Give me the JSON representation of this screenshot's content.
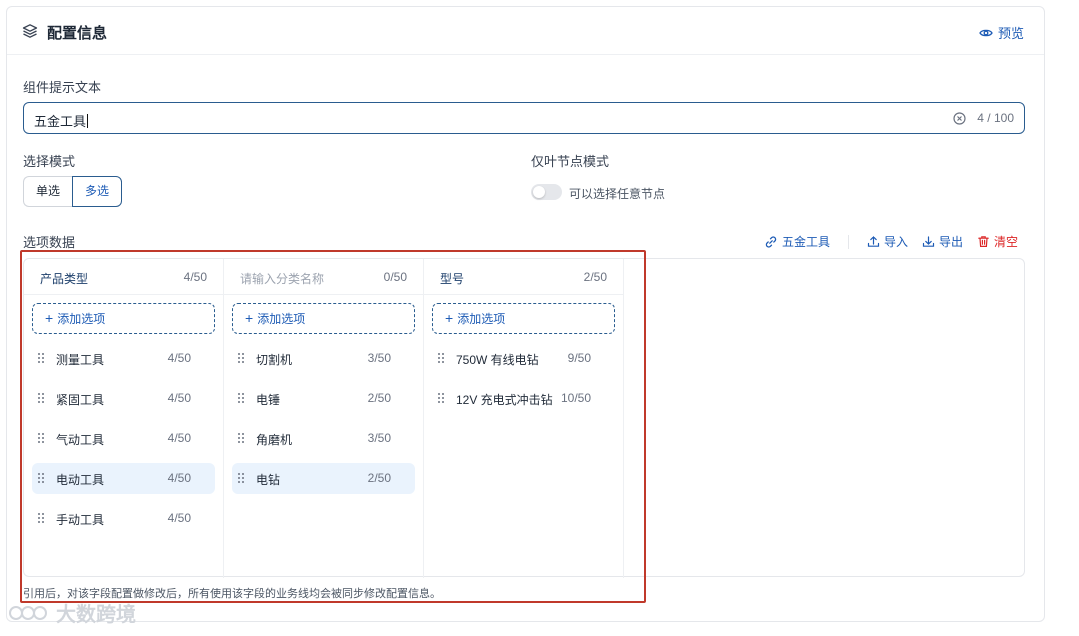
{
  "header": {
    "title": "配置信息",
    "preview_label": "预览"
  },
  "prompt_field": {
    "label": "组件提示文本",
    "value": "五金工具",
    "counter": "4 / 100"
  },
  "select_mode": {
    "label": "选择模式",
    "options": [
      "单选",
      "多选"
    ],
    "selected": "多选"
  },
  "leaf_mode": {
    "label": "仅叶节点模式",
    "toggle_text": "可以选择任意节点",
    "enabled": false
  },
  "options_data": {
    "label": "选项数据",
    "actions": {
      "link": "五金工具",
      "import": "导入",
      "export": "导出",
      "clear": "清空"
    }
  },
  "columns": [
    {
      "title": "产品类型",
      "count": "4/50",
      "placeholder": false,
      "add_label": "添加选项",
      "items": [
        {
          "label": "测量工具",
          "count": "4/50",
          "selected": false
        },
        {
          "label": "紧固工具",
          "count": "4/50",
          "selected": false
        },
        {
          "label": "气动工具",
          "count": "4/50",
          "selected": false
        },
        {
          "label": "电动工具",
          "count": "4/50",
          "selected": true
        },
        {
          "label": "手动工具",
          "count": "4/50",
          "selected": false
        }
      ]
    },
    {
      "title": "请输入分类名称",
      "count": "0/50",
      "placeholder": true,
      "add_label": "添加选项",
      "items": [
        {
          "label": "切割机",
          "count": "3/50",
          "selected": false
        },
        {
          "label": "电锤",
          "count": "2/50",
          "selected": false
        },
        {
          "label": "角磨机",
          "count": "3/50",
          "selected": false
        },
        {
          "label": "电钻",
          "count": "2/50",
          "selected": true
        }
      ]
    },
    {
      "title": "型号",
      "count": "2/50",
      "placeholder": false,
      "add_label": "添加选项",
      "items": [
        {
          "label": "750W 有线电钻",
          "count": "9/50",
          "selected": false
        },
        {
          "label": "12V 充电式冲击钻",
          "count": "10/50",
          "selected": false
        }
      ]
    }
  ],
  "footnote": "引用后，对该字段配置做修改后，所有使用该字段的业务线均会被同步修改配置信息。",
  "watermark": "大数跨境",
  "colors": {
    "accent": "#1d5bb5",
    "danger": "#dc2626",
    "highlight_border": "#c0392b",
    "selected_bg": "#eaf3fd"
  }
}
